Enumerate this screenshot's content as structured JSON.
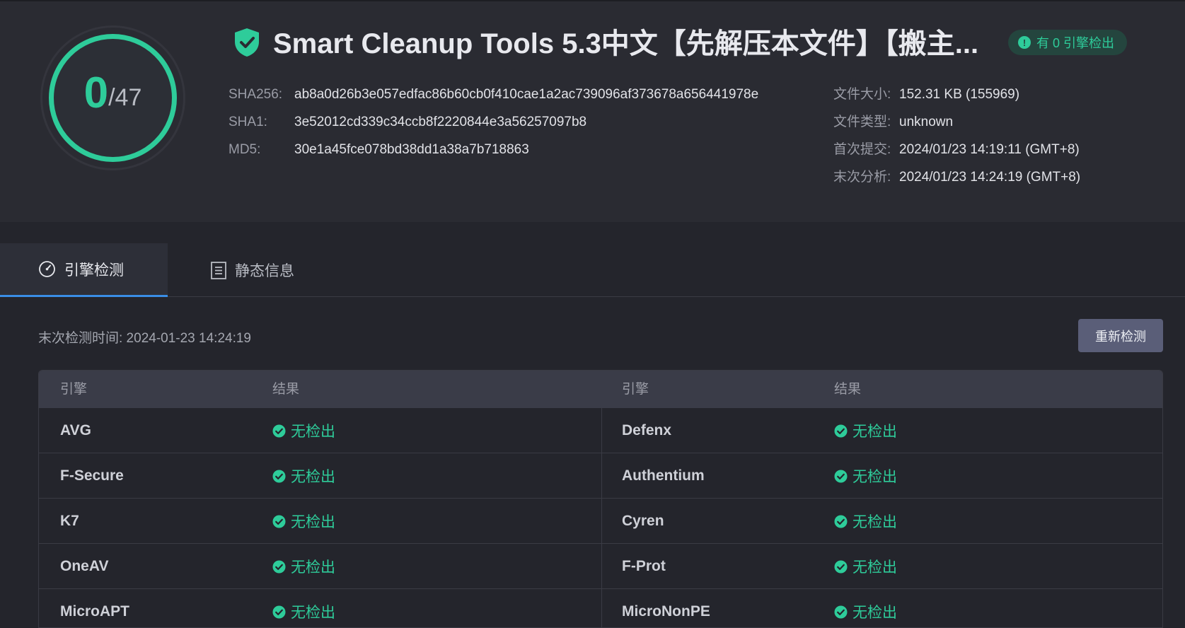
{
  "header": {
    "score": "0",
    "score_total": "/47",
    "title": "Smart Cleanup Tools 5.3中文【先解压本文件】【搬主...",
    "badge": "有 0 引擎检出",
    "badge_icon": "exclamation-icon",
    "accent_color": "#2ecc9a",
    "hashes": [
      {
        "label": "SHA256:",
        "value": "ab8a0d26b3e057edfac86b60cb0f410cae1a2ac739096af373678a656441978e"
      },
      {
        "label": "SHA1:",
        "value": "3e52012cd339c34ccb8f2220844e3a56257097b8"
      },
      {
        "label": "MD5:",
        "value": "30e1a45fce078bd38dd1a38a7b718863"
      }
    ],
    "meta": [
      {
        "label": "文件大小:",
        "value": "152.31 KB (155969)"
      },
      {
        "label": "文件类型:",
        "value": "unknown"
      },
      {
        "label": "首次提交:",
        "value": "2024/01/23 14:19:11 (GMT+8)"
      },
      {
        "label": "末次分析:",
        "value": "2024/01/23 14:24:19 (GMT+8)"
      }
    ]
  },
  "tabs": [
    {
      "label": "引擎检测",
      "icon": "gauge-icon",
      "active": true
    },
    {
      "label": "静态信息",
      "icon": "list-icon",
      "active": false
    }
  ],
  "content": {
    "last_check": "末次检测时间: 2024-01-23 14:24:19",
    "recheck_label": "重新检测",
    "table": {
      "headers": [
        "引擎",
        "结果",
        "引擎",
        "结果"
      ],
      "rows": [
        [
          {
            "engine": "AVG",
            "result": "无检出"
          },
          {
            "engine": "Defenx",
            "result": "无检出"
          }
        ],
        [
          {
            "engine": "F-Secure",
            "result": "无检出"
          },
          {
            "engine": "Authentium",
            "result": "无检出"
          }
        ],
        [
          {
            "engine": "K7",
            "result": "无检出"
          },
          {
            "engine": "Cyren",
            "result": "无检出"
          }
        ],
        [
          {
            "engine": "OneAV",
            "result": "无检出"
          },
          {
            "engine": "F-Prot",
            "result": "无检出"
          }
        ],
        [
          {
            "engine": "MicroAPT",
            "result": "无检出"
          },
          {
            "engine": "MicroNonPE",
            "result": "无检出"
          }
        ]
      ],
      "result_icon": "check-circle-icon"
    }
  }
}
